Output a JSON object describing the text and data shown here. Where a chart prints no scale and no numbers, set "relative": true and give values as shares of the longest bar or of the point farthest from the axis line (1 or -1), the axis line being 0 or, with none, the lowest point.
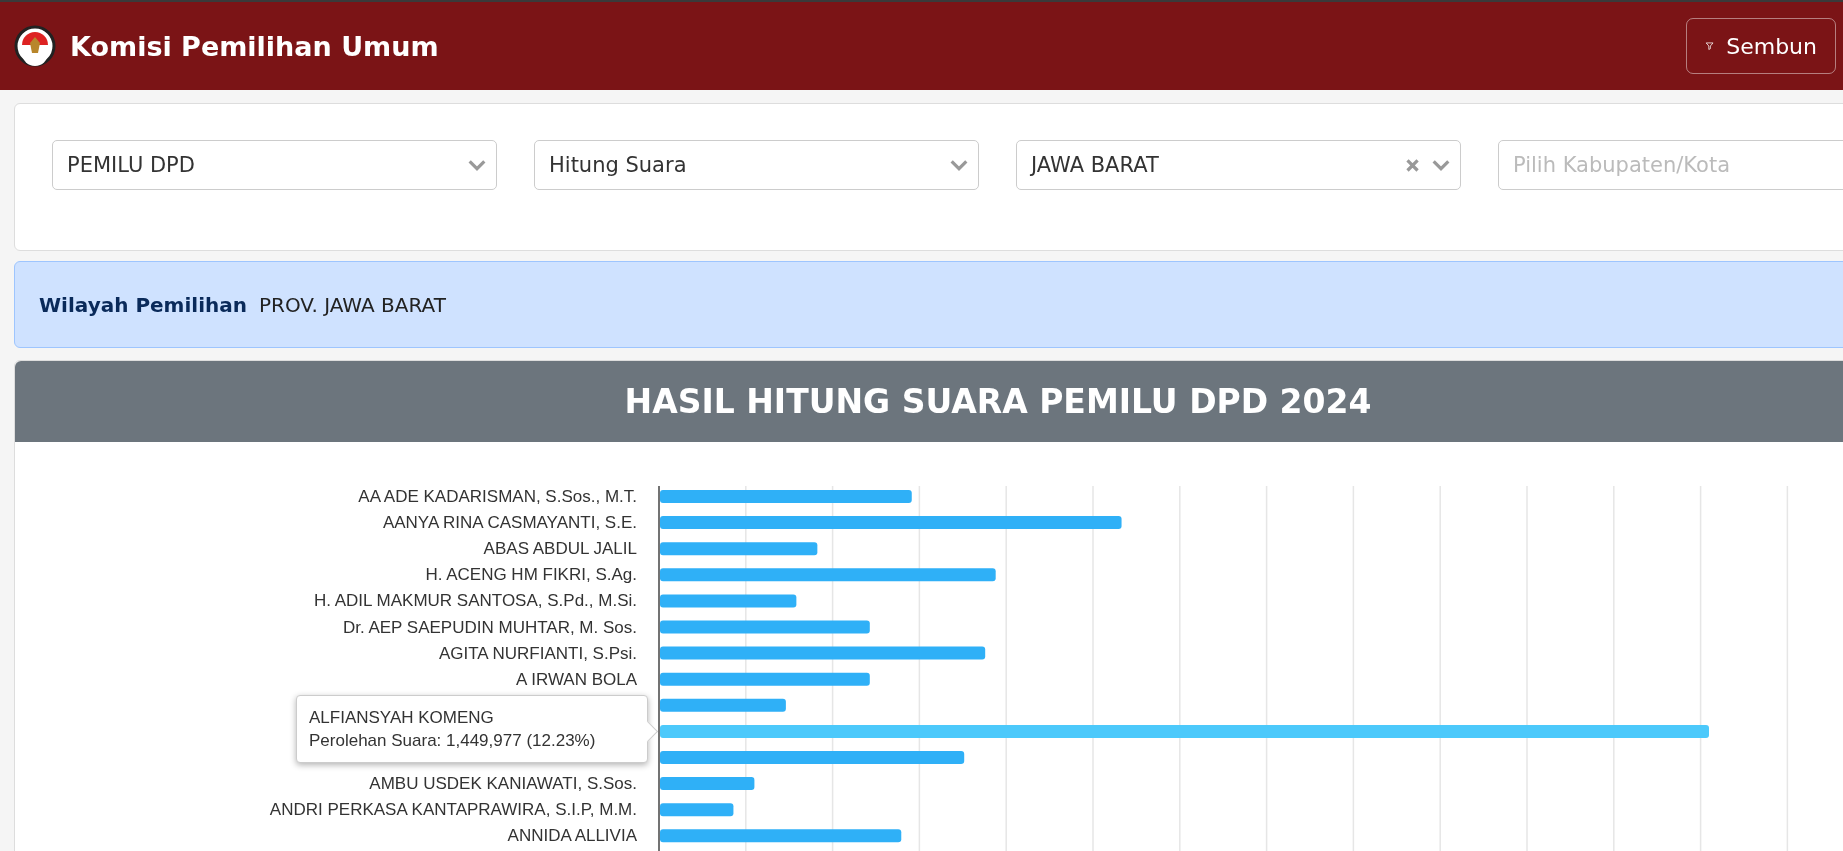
{
  "header": {
    "title": "Komisi Pemilihan Umum",
    "button": "Sembun"
  },
  "filters": [
    {
      "value": "PEMILU DPD",
      "clearable": false
    },
    {
      "value": "Hitung Suara",
      "clearable": false
    },
    {
      "value": "JAWA BARAT",
      "clearable": true
    },
    {
      "placeholder": "Pilih Kabupaten/Kota"
    }
  ],
  "region": {
    "label": "Wilayah Pemilihan",
    "value": "PROV. JAWA BARAT"
  },
  "chart_title": "HASIL HITUNG SUARA PEMILU DPD 2024",
  "chart_data": {
    "type": "bar",
    "orientation": "horizontal",
    "relative": true,
    "categories": [
      "AA ADE KADARISMAN, S.Sos., M.T.",
      "AANYA RINA CASMAYANTI, S.E.",
      "ABAS ABDUL JALIL",
      "H. ACENG HM FIKRI, S.Ag.",
      "H. ADIL MAKMUR SANTOSA, S.Pd., M.Si.",
      "Dr. AEP SAEPUDIN MUHTAR, M. Sos.",
      "AGITA NURFIANTI, S.Psi.",
      "A IRWAN BOLA",
      null,
      null,
      null,
      "AMBU USDEK KANIAWATI, S.Sos.",
      "ANDRI PERKASA KANTAPRAWIRA, S.I.P, M.M.",
      "ANNIDA ALLIVIA"
    ],
    "values": [
      0.24,
      0.44,
      0.15,
      0.32,
      0.13,
      0.2,
      0.31,
      0.2,
      0.12,
      1,
      0.29,
      0.09,
      0.07,
      0.23
    ]
  },
  "bars": [
    {
      "highlighted": false
    },
    {
      "highlighted": false
    },
    {
      "highlighted": false
    },
    {
      "highlighted": false
    },
    {
      "highlighted": false
    },
    {
      "highlighted": false
    },
    {
      "highlighted": false
    },
    {
      "highlighted": false
    },
    {
      "highlighted": false
    },
    {
      "highlighted": true
    },
    {
      "highlighted": false
    },
    {
      "highlighted": false
    },
    {
      "highlighted": false
    },
    {
      "highlighted": false
    }
  ],
  "tooltip": {
    "title": "ALFIANSYAH KOMENG",
    "text": "Perolehan Suara: 1,449,977 (12.23%)"
  }
}
